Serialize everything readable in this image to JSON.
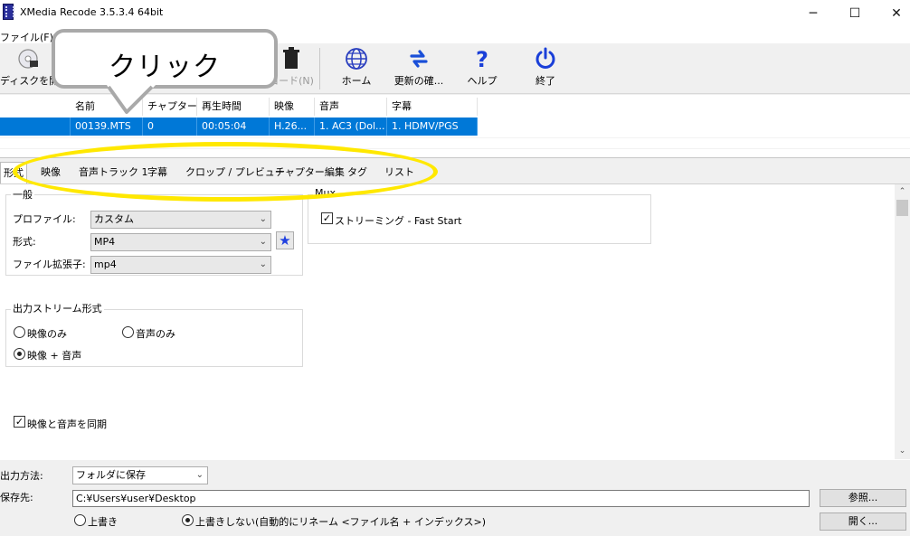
{
  "window": {
    "title": "XMedia Recode 3.5.3.4 64bit",
    "min": "─",
    "max": "☐",
    "close": "✕"
  },
  "menu": {
    "file": "ファイル(F)"
  },
  "toolbar": {
    "open_disc": "ディスクを開く",
    "encode": "コード(N)",
    "home": "ホーム",
    "update": "更新の確...",
    "help": "ヘルプ",
    "exit": "終了"
  },
  "callout": {
    "text": "クリック"
  },
  "filelist": {
    "columns": [
      "名前",
      "チャプター",
      "再生時間",
      "映像",
      "音声",
      "字幕"
    ],
    "rows": [
      [
        "00139.MTS",
        "0",
        "00:05:04",
        "H.26...",
        "1. AC3 (Dol...",
        "1. HDMV/PGS"
      ]
    ]
  },
  "tabs": [
    "形式",
    "映像",
    "音声トラック 1",
    "字幕",
    "クロップ / プレビュー",
    "チャプター編集",
    "タグ",
    "リスト"
  ],
  "general": {
    "title": "一般",
    "profile_label": "プロファイル:",
    "profile_value": "カスタム",
    "format_label": "形式:",
    "format_value": "MP4",
    "ext_label": "ファイル拡張子:",
    "ext_value": "mp4"
  },
  "mux": {
    "title": "Mux",
    "streaming": "ストリーミング - Fast Start",
    "streaming_checked": true
  },
  "output_stream": {
    "title": "出力ストリーム形式",
    "video_only": "映像のみ",
    "audio_only": "音声のみ",
    "video_audio": "映像 + 音声",
    "selected": "video_audio"
  },
  "sync": {
    "label": "映像と音声を同期",
    "checked": true
  },
  "bottom": {
    "output_method_label": "出力方法:",
    "output_method_value": "フォルダに保存",
    "save_to_label": "保存先:",
    "save_path": "C:¥Users¥user¥Desktop",
    "browse": "参照...",
    "open": "開く...",
    "overwrite": "上書き",
    "no_overwrite": "上書きしない(自動的にリネーム <ファイル名 + インデックス>)"
  },
  "colors": {
    "selection": "#0078d7",
    "highlight": "#ffe800",
    "star": "#2040e0"
  }
}
